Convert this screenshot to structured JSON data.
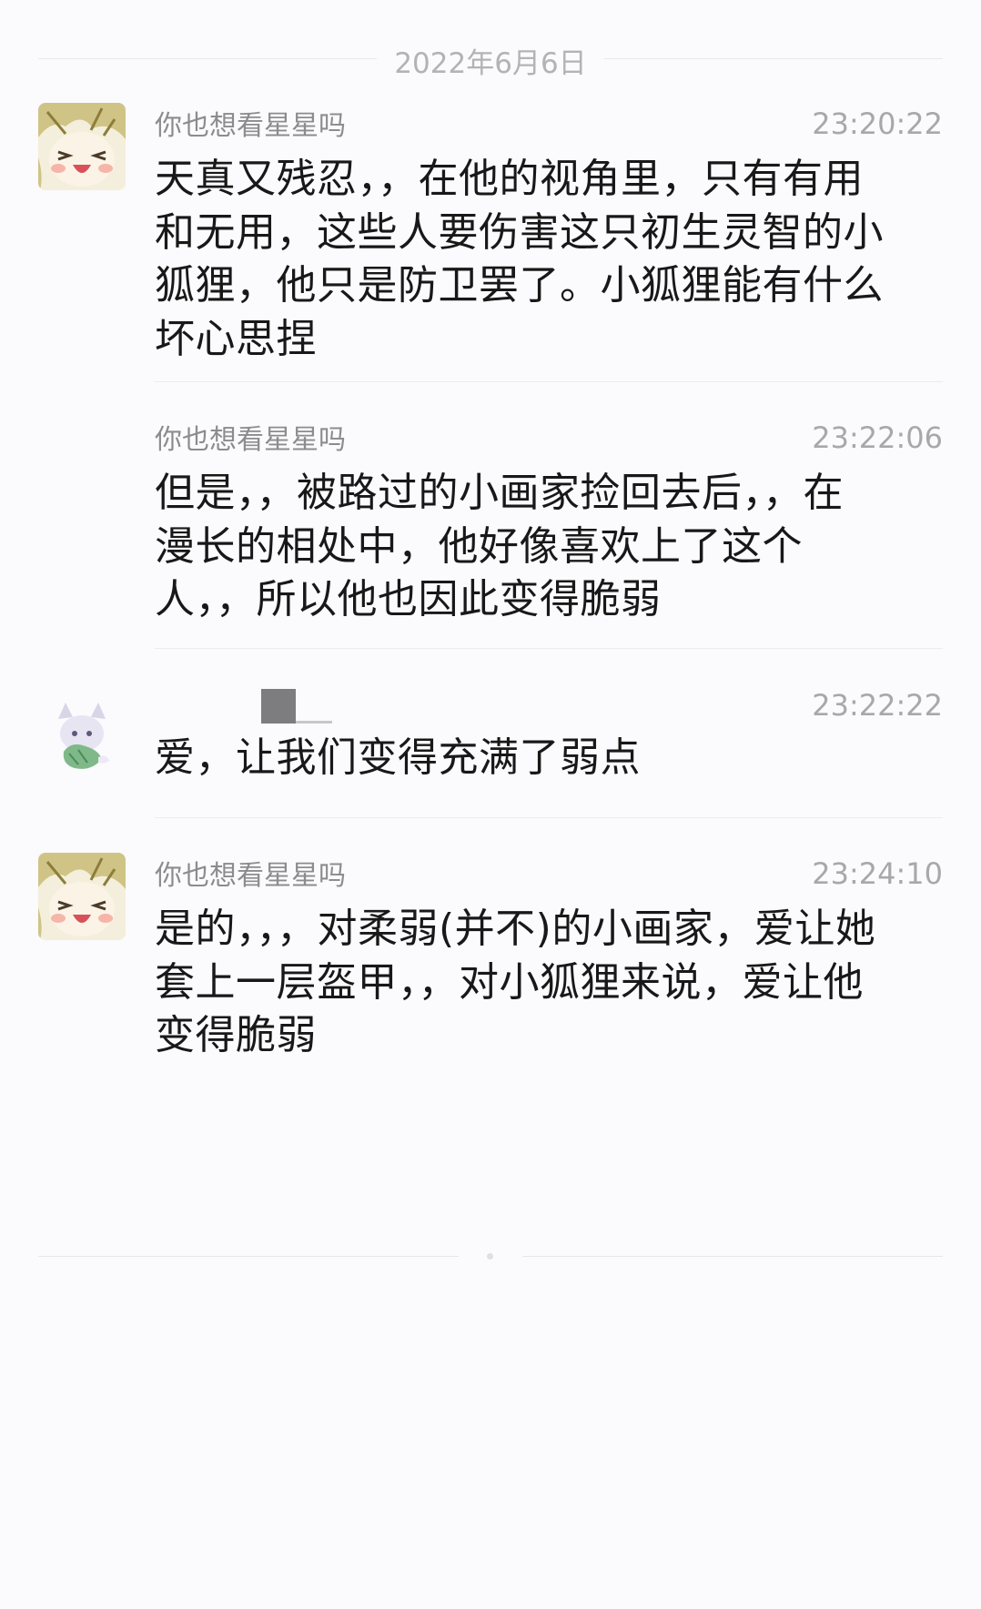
{
  "date_divider": "2022年6月6日",
  "messages": [
    {
      "sender": "你也想看星星吗",
      "time": "23:20:22",
      "text": "天真又残忍，，在他的视角里，只有有用\n和无用，这些人要伤害这只初生灵智的小\n狐狸，他只是防卫罢了。小狐狸能有什么\n坏心思捏"
    },
    {
      "sender": "你也想看星星吗",
      "time": "23:22:06",
      "text": "但是，，被路过的小画家捡回去后，，在\n漫长的相处中，他好像喜欢上了这个\n人，，所以他也因此变得脆弱"
    },
    {
      "sender": "",
      "time": "23:22:22",
      "text": "爱，让我们变得充满了弱点"
    },
    {
      "sender": "你也想看星星吗",
      "time": "23:24:10",
      "text": "是的，，，对柔弱(并不)的小画家，爱让她\n套上一层盔甲，，对小狐狸来说，爱让他\n变得脆弱"
    }
  ],
  "icons": {
    "avatar_1": "anime-boy-avatar-icon",
    "avatar_2": "fox-girl-avatar-icon"
  }
}
